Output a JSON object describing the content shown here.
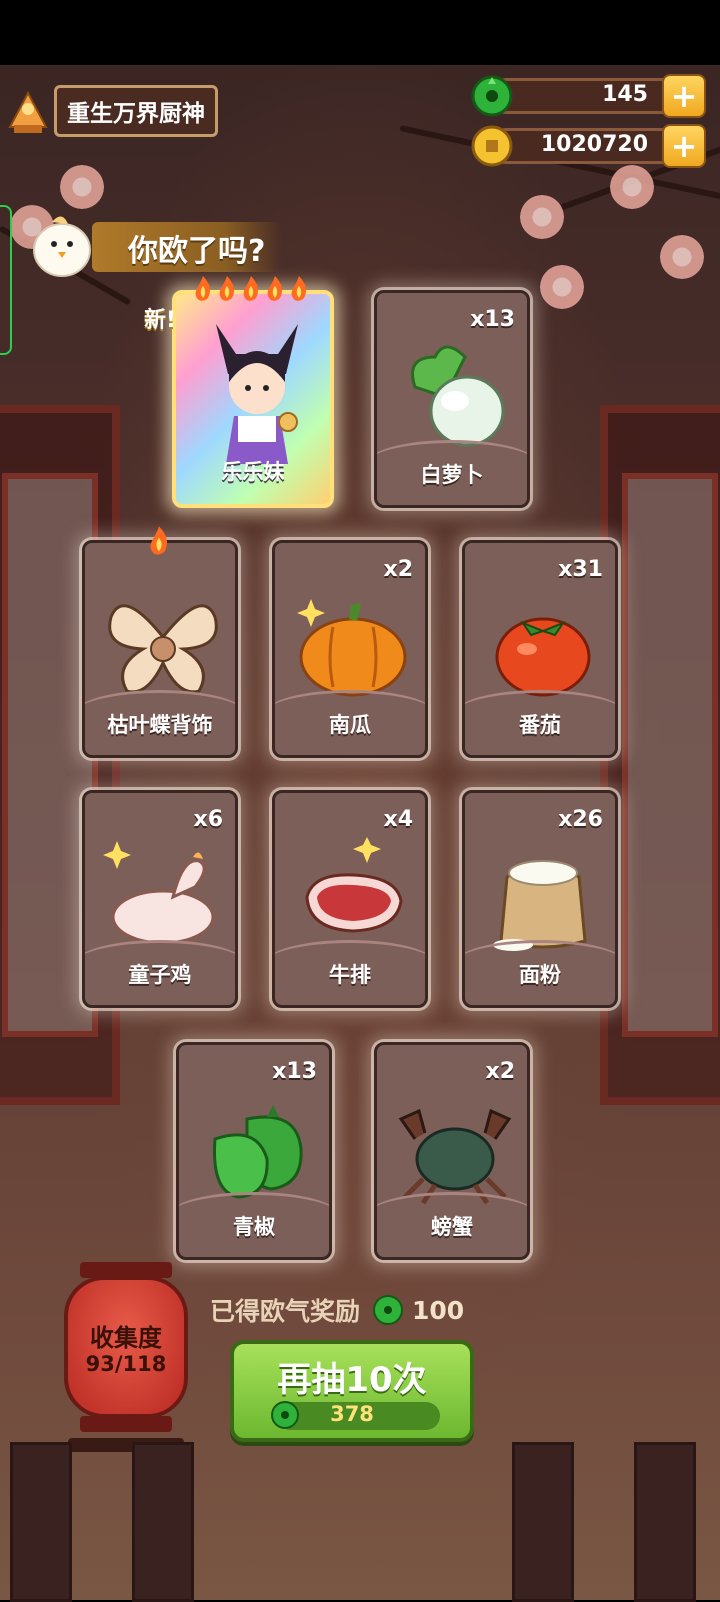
{
  "header": {
    "title": "重生万界厨神",
    "currency": [
      {
        "icon": "green-jade-icon",
        "value": "145"
      },
      {
        "icon": "gold-coin-icon",
        "value": "1020720"
      }
    ]
  },
  "banner": {
    "text": "你欧了吗?"
  },
  "hero_card": {
    "badge": "新!",
    "name": "乐乐妹",
    "flames": 5
  },
  "cards": [
    {
      "name": "白萝卜",
      "count": "x13",
      "icon": "white-radish-icon"
    },
    {
      "name": "枯叶蝶背饰",
      "count": "",
      "icon": "butterfly-wings-icon",
      "flame": true
    },
    {
      "name": "南瓜",
      "count": "x2",
      "icon": "pumpkin-icon"
    },
    {
      "name": "番茄",
      "count": "x31",
      "icon": "tomato-icon"
    },
    {
      "name": "童子鸡",
      "count": "x6",
      "icon": "chicken-icon"
    },
    {
      "name": "牛排",
      "count": "x4",
      "icon": "steak-icon"
    },
    {
      "name": "面粉",
      "count": "x26",
      "icon": "flour-sack-icon"
    },
    {
      "name": "青椒",
      "count": "x13",
      "icon": "green-pepper-icon"
    },
    {
      "name": "螃蟹",
      "count": "x2",
      "icon": "crab-icon"
    }
  ],
  "collection": {
    "label": "收集度",
    "value": "93/118"
  },
  "reward": {
    "text": "已得欧气奖励",
    "value": "100"
  },
  "draw_button": {
    "label": "再抽10次",
    "cost": "378"
  },
  "colors": {
    "accent_green": "#6cb830",
    "gold": "#f0a820",
    "card_bg": "#7d5f59"
  }
}
